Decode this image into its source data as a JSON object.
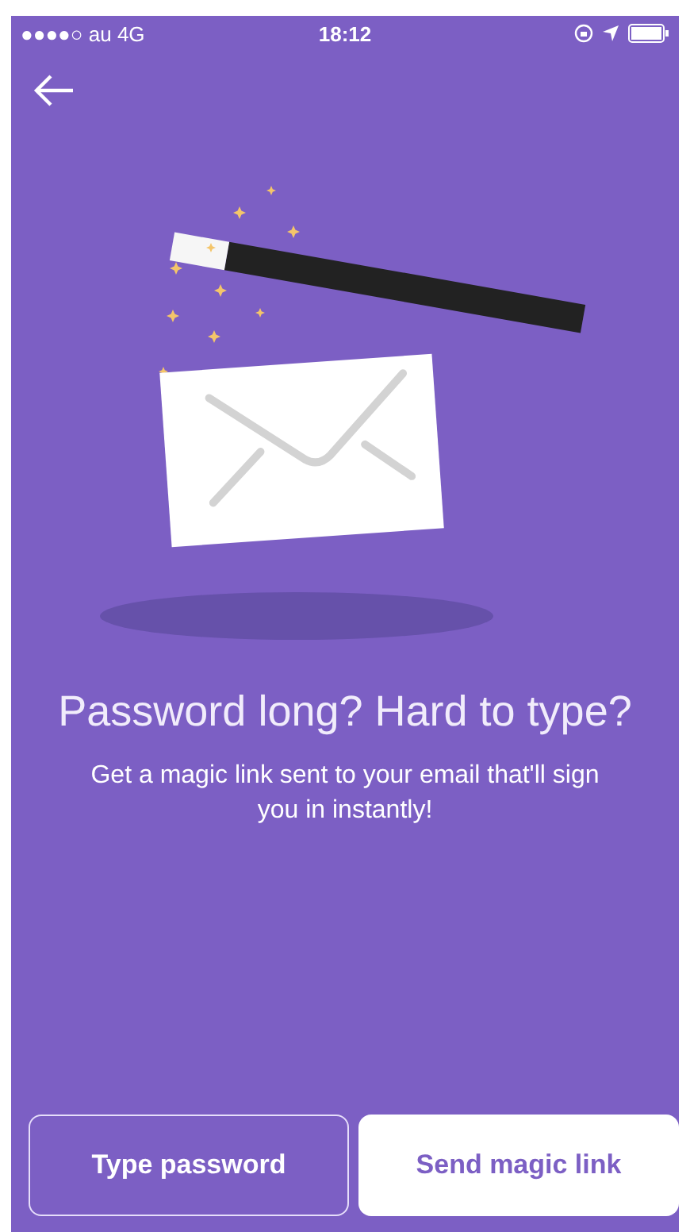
{
  "status_bar": {
    "carrier": "●●●●○ au  4G",
    "time": "18:12"
  },
  "heading": "Password long? Hard to type?",
  "description": "Get a magic link sent to your email that'll sign you in instantly!",
  "buttons": [
    {
      "label": "Type password",
      "kind": "outline"
    },
    {
      "label": "Send magic link",
      "kind": "filled"
    }
  ]
}
